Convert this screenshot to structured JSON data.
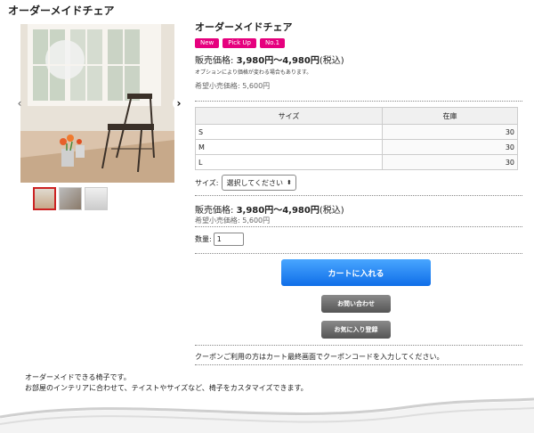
{
  "page": {
    "title": "オーダーメイドチェア"
  },
  "gallery": {
    "prev_icon": "‹",
    "next_icon": "›"
  },
  "product": {
    "name": "オーダーメイドチェア",
    "badges": [
      "New",
      "Pick Up",
      "No.1"
    ],
    "price_label": "販売価格:",
    "price_value": "3,980円〜4,980円",
    "tax": "(税込)",
    "option_note": "オプションにより価格が変わる場合もあります。",
    "retail_label": "希望小売価格:",
    "retail_value": "5,600円"
  },
  "stock_table": {
    "headers": [
      "サイズ",
      "在庫"
    ],
    "rows": [
      {
        "size": "S",
        "stock": "30"
      },
      {
        "size": "M",
        "stock": "30"
      },
      {
        "size": "L",
        "stock": "30"
      }
    ]
  },
  "size_select": {
    "label": "サイズ:",
    "value": "選択してください"
  },
  "price2": {
    "label": "販売価格:",
    "value": "3,980円〜4,980円",
    "tax": "(税込)",
    "retail": "希望小売価格: 5,600円"
  },
  "quantity": {
    "label": "数量:",
    "value": "1"
  },
  "buttons": {
    "cart": "カートに入れる",
    "inquiry": "お問い合わせ",
    "favorite": "お気に入り登録"
  },
  "coupon_text": "クーポンご利用の方はカート最終画面でクーポンコードを入力してください。",
  "description": [
    "オーダーメイドできる椅子です。",
    "お部屋のインテリアに合わせて、テイストやサイズなど、椅子をカスタマイズできます。"
  ],
  "colors": {
    "badge": "#e6007e",
    "cart_button": "#1a7cf0",
    "gray_button": "#666666"
  }
}
